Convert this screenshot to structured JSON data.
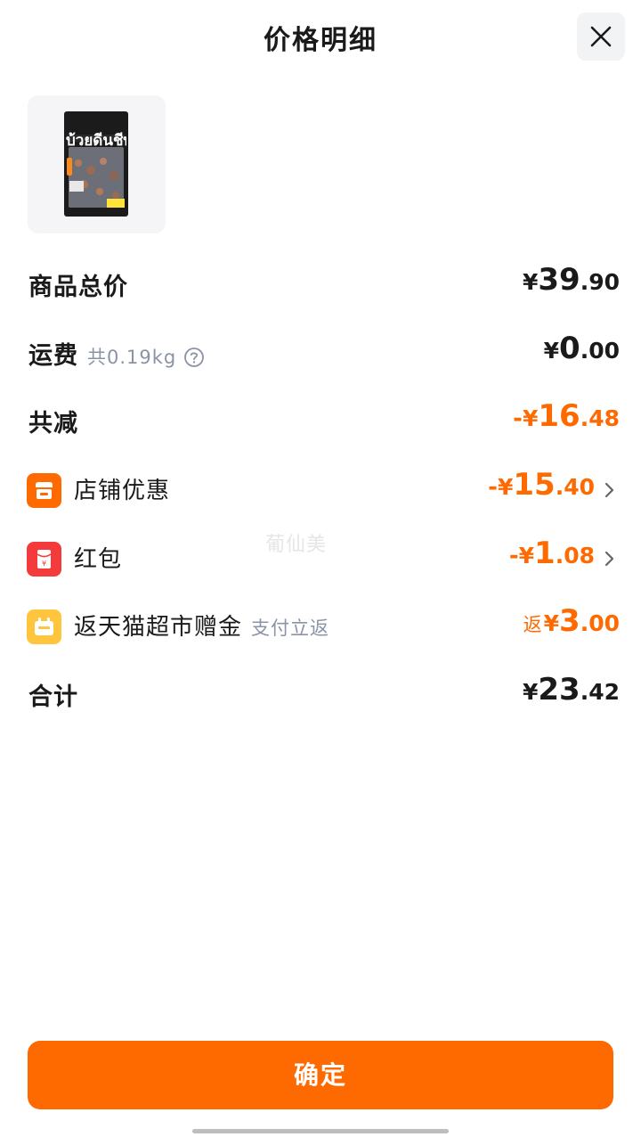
{
  "header": {
    "title": "价格明细",
    "close_icon": "close-icon"
  },
  "product": {
    "image_icon": "product-thumbnail",
    "package_text": "บ้วยดีนชีพ"
  },
  "rows": {
    "goods_total": {
      "label": "商品总价",
      "currency": "¥",
      "int": "39",
      "dec": ".90"
    },
    "shipping": {
      "label": "运费",
      "sub": "共0.19kg",
      "help_icon": "question-circle-icon",
      "currency": "¥",
      "int": "0",
      "dec": ".00"
    },
    "total_discount": {
      "label": "共减",
      "sign": "-",
      "currency": "¥",
      "int": "16",
      "dec": ".48"
    },
    "shop_discount": {
      "label": "店铺优惠",
      "icon": "shop-icon",
      "sign": "-",
      "currency": "¥",
      "int": "15",
      "dec": ".40"
    },
    "red_packet": {
      "label": "红包",
      "icon": "red-packet-icon",
      "sign": "-",
      "currency": "¥",
      "int": "1",
      "dec": ".08"
    },
    "cashback": {
      "label": "返天猫超市赠金",
      "sub": "支付立返",
      "icon": "tmall-market-icon",
      "prefix": "返",
      "currency": "¥",
      "int": "3",
      "dec": ".00"
    },
    "grand_total": {
      "label": "合计",
      "currency": "¥",
      "int": "23",
      "dec": ".42"
    }
  },
  "watermark": "葡仙美",
  "confirm_button": {
    "label": "确定"
  },
  "colors": {
    "accent": "#ff6a00",
    "shop_icon_bg": "#ff6a00",
    "red_packet_bg": "#f43a3a",
    "tmall_icon_bg": "#ffc53d",
    "sub_text": "#8a94a6"
  }
}
